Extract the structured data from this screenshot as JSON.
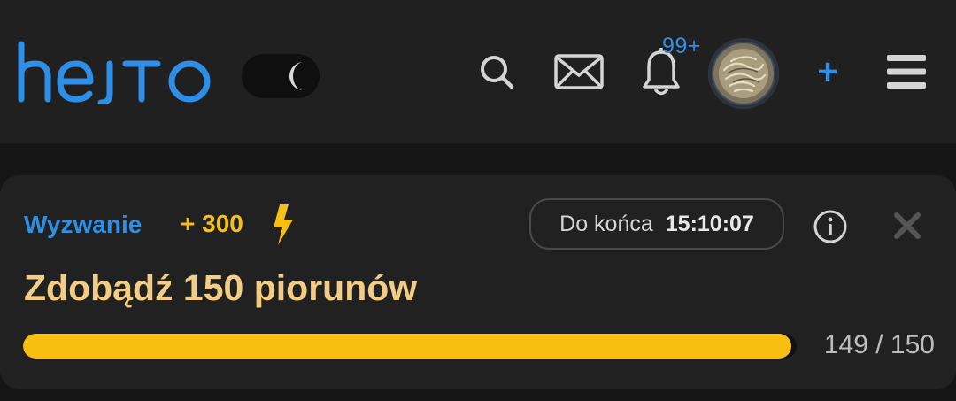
{
  "header": {
    "logo_text": "hejto",
    "notifications_count": "99+",
    "icons": [
      "search-icon",
      "mail-icon",
      "bell-icon",
      "plus-icon",
      "menu-icon",
      "moon-icon"
    ],
    "new_post_label": "+"
  },
  "challenge": {
    "label": "Wyzwanie",
    "reward": "+ 300",
    "countdown_label": "Do końca",
    "countdown_time": "15:10:07",
    "title": "Zdobądź 150 piorunów",
    "progress_current": 149,
    "progress_total": 150,
    "progress_text": "149 / 150"
  },
  "colors": {
    "accent_blue": "#2f8fe6",
    "accent_yellow": "#f7bf14",
    "title_color": "#f3cd85",
    "header_bg": "#202020",
    "card_bg": "#212121"
  }
}
